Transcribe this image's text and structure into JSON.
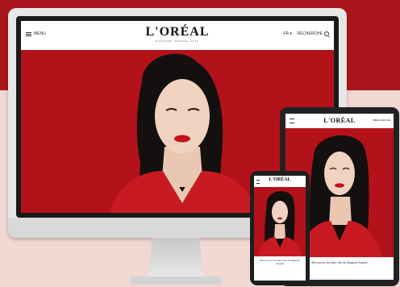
{
  "colors": {
    "brand_red": "#b3121b",
    "background_pink": "#f1d8d2",
    "top_band": "#a8161c"
  },
  "desktop": {
    "menu_label": "MENU",
    "brand": "L'ORÉAL",
    "brand_subtitle": "RAPPORT ANNUEL 2019",
    "language": "FR",
    "search_label": "RECHERCHE"
  },
  "tablet": {
    "brand": "L'ORÉAL",
    "language": "FR",
    "search_label": "RECHERCHE",
    "caption": "Découvrez les faits clés du Rapport Annuel"
  },
  "phone": {
    "brand": "L'ORÉAL",
    "caption": "Découvrez les faits clés du Rapport Annuel"
  }
}
